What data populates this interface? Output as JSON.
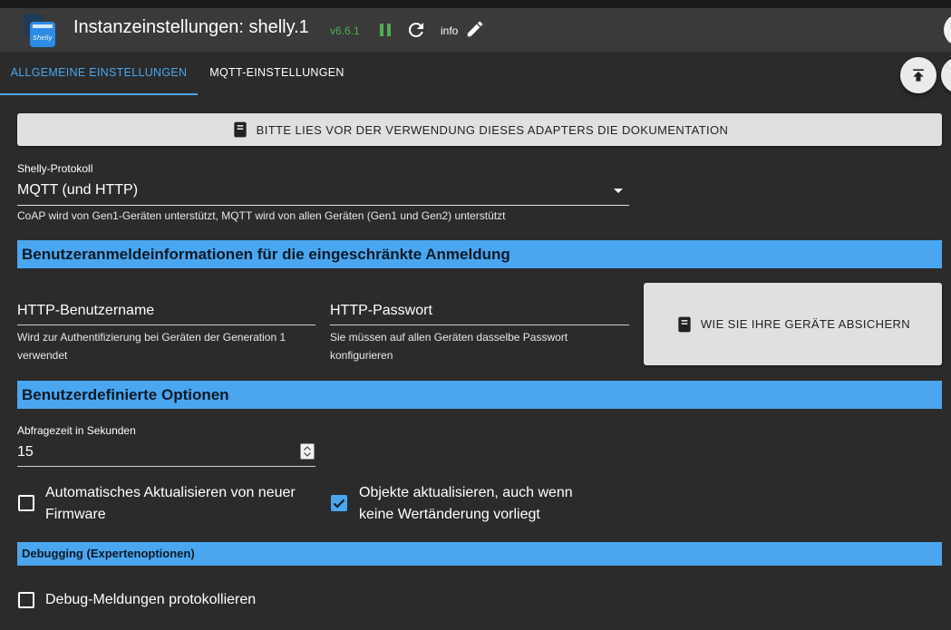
{
  "header": {
    "title": "Instanzeinstellungen: shelly.1",
    "version": "v6.6.1",
    "info_label": "info",
    "icons": [
      "shelly-logo-icon",
      "pause-icon",
      "refresh-icon",
      "pencil-icon"
    ],
    "colors": {
      "version": "#4caf50",
      "pause": "#4caf50"
    }
  },
  "tabs": [
    {
      "label": "ALLGEMEINE EINSTELLUNGEN",
      "active": true
    },
    {
      "label": "MQTT-EINSTELLUNGEN",
      "active": false
    }
  ],
  "doc_button": {
    "label": "BITTE LIES VOR DER VERWENDUNG DIESES ADAPTERS DIE DOKUMENTATION",
    "icon": "book-icon"
  },
  "protocol": {
    "label": "Shelly-Protokoll",
    "value": "MQTT (und HTTP)",
    "helper": "CoAP wird von Gen1-Geräten unterstützt, MQTT wird von allen Geräten (Gen1 und Gen2) unterstützt"
  },
  "sections": {
    "credentials": "Benutzeranmeldeinformationen für die eingeschränkte Anmeldung",
    "custom": "Benutzerdefinierte Optionen",
    "debug": "Debugging (Expertenoptionen)"
  },
  "credentials": {
    "username": {
      "label": "HTTP-Benutzername",
      "helper_line1": "Wird zur Authentifizierung bei Geräten der Generation 1",
      "helper_line2": "verwendet"
    },
    "password": {
      "label": "HTTP-Passwort",
      "helper_line1": "Sie müssen auf allen Geräten dasselbe Passwort",
      "helper_line2": "konfigurieren"
    },
    "secure_button": "WIE SIE IHRE GERÄTE ABSICHERN"
  },
  "polling": {
    "label": "Abfragezeit in Sekunden",
    "value": "15"
  },
  "checkboxes": {
    "firmware": {
      "line1": "Automatisches Aktualisieren von neuer",
      "line2": "Firmware",
      "checked": false
    },
    "objects": {
      "line1": "Objekte aktualisieren, auch wenn",
      "line2": "keine Wertänderung vorliegt",
      "checked": true
    },
    "debug": {
      "label": "Debug-Meldungen protokollieren",
      "checked": false
    }
  },
  "colors": {
    "accent": "#4aa6ef",
    "background": "#2b2b2b",
    "header": "#3a3a3a"
  }
}
